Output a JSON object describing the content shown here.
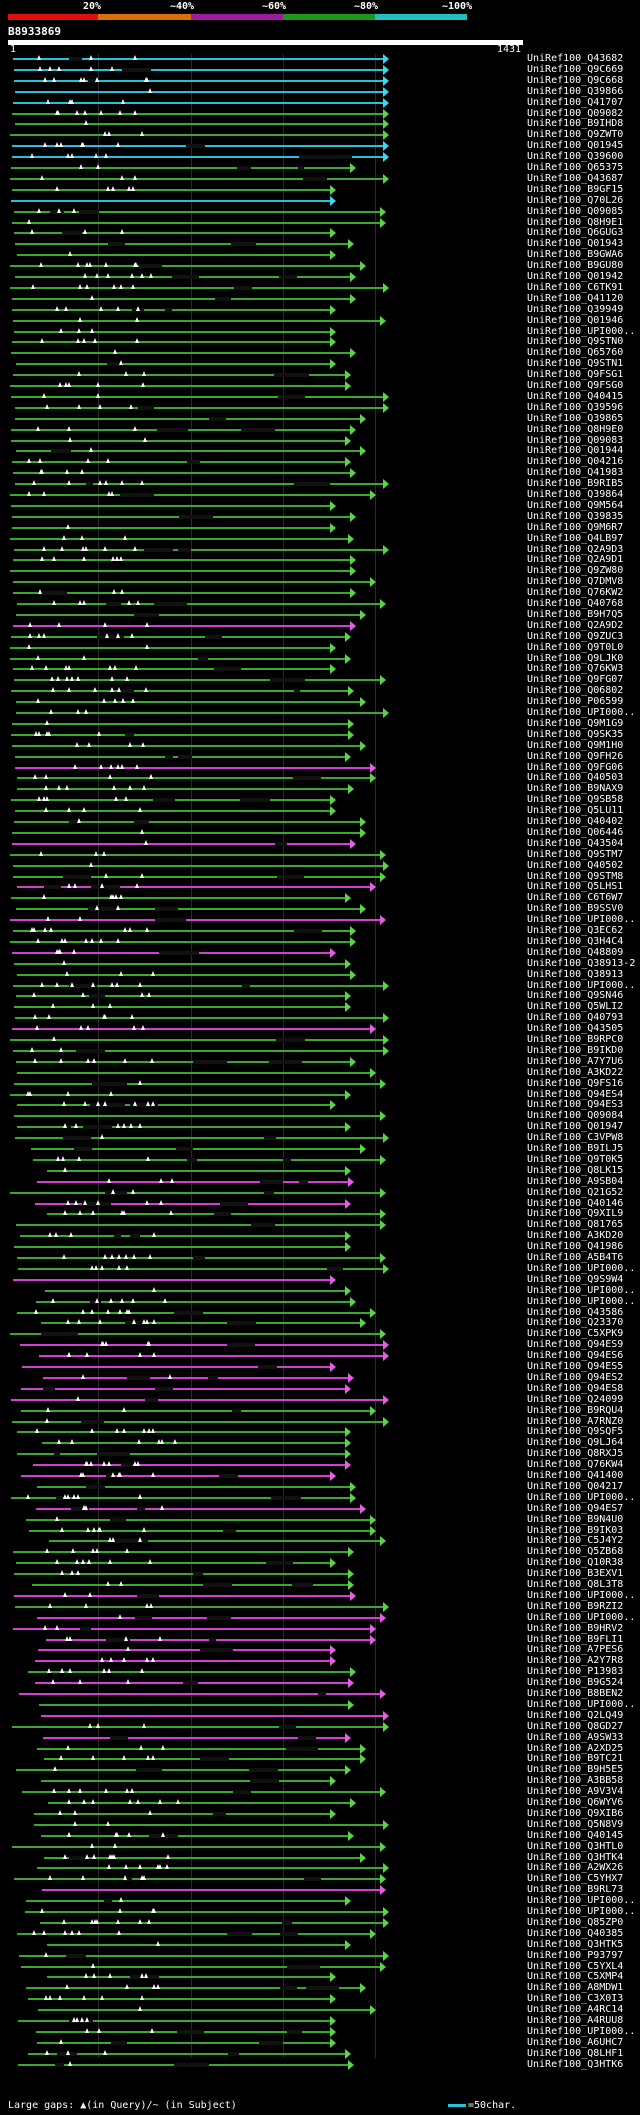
{
  "scale": {
    "labels": [
      "20%",
      "~40%",
      "~60%",
      "~80%",
      "~100%"
    ],
    "bands": [
      "#e01010",
      "#d8700a",
      "#a01aa0",
      "#1a9a1a",
      "#20c0c0"
    ]
  },
  "query": {
    "id": "B8933869",
    "start": "1",
    "end": "1431"
  },
  "colors": {
    "green": "#3aa82e",
    "magenta": "#d23fd2",
    "cyan": "#29bfd9",
    "arrow_green": "#5bd44a",
    "arrow_magenta": "#e060e0",
    "arrow_cyan": "#3cd8f0"
  },
  "legend": {
    "left": "Large gaps: ▲(in Query)/~ (in Subject)",
    "right": "=50char."
  },
  "hits": [
    {
      "label": "UniRef100_Q43682",
      "color": "cyan"
    },
    {
      "label": "UniRef100_Q9C669",
      "color": "cyan"
    },
    {
      "label": "UniRef100_Q9C668",
      "color": "cyan"
    },
    {
      "label": "UniRef100_Q39866",
      "color": "cyan"
    },
    {
      "label": "UniRef100_Q41707",
      "color": "cyan"
    },
    {
      "label": "UniRef100_Q09082",
      "color": "green"
    },
    {
      "label": "UniRef100_B9IHD8",
      "color": "green"
    },
    {
      "label": "UniRef100_Q9ZWT0",
      "color": "green"
    },
    {
      "label": "UniRef100_Q01945",
      "color": "cyan"
    },
    {
      "label": "UniRef100_Q39600",
      "color": "cyan"
    },
    {
      "label": "UniRef100_Q65375",
      "color": "green"
    },
    {
      "label": "UniRef100_Q43687",
      "color": "green"
    },
    {
      "label": "UniRef100_B9GF15",
      "color": "green"
    },
    {
      "label": "UniRef100_Q70L26",
      "color": "cyan"
    },
    {
      "label": "UniRef100_Q09085",
      "color": "green"
    },
    {
      "label": "UniRef100_Q8H9E1",
      "color": "green"
    },
    {
      "label": "UniRef100_Q6GUG3",
      "color": "green"
    },
    {
      "label": "UniRef100_Q01943",
      "color": "green"
    },
    {
      "label": "UniRef100_B9GWA6",
      "color": "green"
    },
    {
      "label": "UniRef100_B9GU80",
      "color": "green"
    },
    {
      "label": "UniRef100_Q01942",
      "color": "green"
    },
    {
      "label": "UniRef100_C6TK91",
      "color": "green"
    },
    {
      "label": "UniRef100_Q41120",
      "color": "green"
    },
    {
      "label": "UniRef100_Q39949",
      "color": "green"
    },
    {
      "label": "UniRef100_Q01946",
      "color": "green"
    },
    {
      "label": "UniRef100_UPI000..",
      "color": "green"
    },
    {
      "label": "UniRef100_Q9STN0",
      "color": "green"
    },
    {
      "label": "UniRef100_Q65760",
      "color": "green"
    },
    {
      "label": "UniRef100_Q9STN1",
      "color": "green"
    },
    {
      "label": "UniRef100_Q9FSG1",
      "color": "green"
    },
    {
      "label": "UniRef100_Q9FSG0",
      "color": "green"
    },
    {
      "label": "UniRef100_Q40415",
      "color": "green"
    },
    {
      "label": "UniRef100_Q39596",
      "color": "green"
    },
    {
      "label": "UniRef100_Q39865",
      "color": "green"
    },
    {
      "label": "UniRef100_Q8H9E0",
      "color": "green"
    },
    {
      "label": "UniRef100_Q09083",
      "color": "green"
    },
    {
      "label": "UniRef100_Q01944",
      "color": "green"
    },
    {
      "label": "UniRef100_Q04216",
      "color": "green"
    },
    {
      "label": "UniRef100_Q41983",
      "color": "green"
    },
    {
      "label": "UniRef100_B9RIB5",
      "color": "green"
    },
    {
      "label": "UniRef100_Q39864",
      "color": "green"
    },
    {
      "label": "UniRef100_Q9M564",
      "color": "green"
    },
    {
      "label": "UniRef100_Q39835",
      "color": "green"
    },
    {
      "label": "UniRef100_Q9M6R7",
      "color": "green"
    },
    {
      "label": "UniRef100_Q4LB97",
      "color": "green"
    },
    {
      "label": "UniRef100_Q2A9D3",
      "color": "green"
    },
    {
      "label": "UniRef100_Q2A9D1",
      "color": "green"
    },
    {
      "label": "UniRef100_Q9ZW80",
      "color": "green"
    },
    {
      "label": "UniRef100_Q7DMV8",
      "color": "green"
    },
    {
      "label": "UniRef100_Q76KW2",
      "color": "green"
    },
    {
      "label": "UniRef100_Q40768",
      "color": "green"
    },
    {
      "label": "UniRef100_B9H7Q5",
      "color": "green"
    },
    {
      "label": "UniRef100_Q2A9D2",
      "color": "magenta"
    },
    {
      "label": "UniRef100_Q9ZUC3",
      "color": "green"
    },
    {
      "label": "UniRef100_Q9T0L0",
      "color": "green"
    },
    {
      "label": "UniRef100_Q9LJK0",
      "color": "green"
    },
    {
      "label": "UniRef100_Q76KW3",
      "color": "green"
    },
    {
      "label": "UniRef100_Q9FG07",
      "color": "green"
    },
    {
      "label": "UniRef100_Q06802",
      "color": "green"
    },
    {
      "label": "UniRef100_P06599",
      "color": "green"
    },
    {
      "label": "UniRef100_UPI000..",
      "color": "green"
    },
    {
      "label": "UniRef100_Q9M1G9",
      "color": "green"
    },
    {
      "label": "UniRef100_Q9SK35",
      "color": "green"
    },
    {
      "label": "UniRef100_Q9M1H0",
      "color": "green"
    },
    {
      "label": "UniRef100_Q9FH26",
      "color": "green"
    },
    {
      "label": "UniRef100_Q9FG06",
      "color": "magenta"
    },
    {
      "label": "UniRef100_Q40503",
      "color": "green"
    },
    {
      "label": "UniRef100_B9NAX9",
      "color": "green"
    },
    {
      "label": "UniRef100_Q9SB58",
      "color": "green"
    },
    {
      "label": "UniRef100_Q5LU11",
      "color": "green"
    },
    {
      "label": "UniRef100_Q40402",
      "color": "green"
    },
    {
      "label": "UniRef100_Q06446",
      "color": "green"
    },
    {
      "label": "UniRef100_Q43504",
      "color": "magenta"
    },
    {
      "label": "UniRef100_Q9STM7",
      "color": "green"
    },
    {
      "label": "UniRef100_Q40502",
      "color": "green"
    },
    {
      "label": "UniRef100_Q9STM8",
      "color": "green"
    },
    {
      "label": "UniRef100_Q5LHS1",
      "color": "magenta"
    },
    {
      "label": "UniRef100_C6T6W7",
      "color": "green"
    },
    {
      "label": "UniRef100_B9SSV0",
      "color": "green"
    },
    {
      "label": "UniRef100_UPI000..",
      "color": "magenta"
    },
    {
      "label": "UniRef100_Q3EC62",
      "color": "green"
    },
    {
      "label": "UniRef100_Q3H4C4",
      "color": "green"
    },
    {
      "label": "UniRef100_Q48809",
      "color": "magenta"
    },
    {
      "label": "UniRef100_Q38913-2",
      "color": "green"
    },
    {
      "label": "UniRef100_Q38913",
      "color": "green"
    },
    {
      "label": "UniRef100_UPI000..",
      "color": "green"
    },
    {
      "label": "UniRef100_Q9SN46",
      "color": "green"
    },
    {
      "label": "UniRef100_Q5WLI2",
      "color": "green"
    },
    {
      "label": "UniRef100_Q40793",
      "color": "green"
    },
    {
      "label": "UniRef100_Q43505",
      "color": "magenta"
    },
    {
      "label": "UniRef100_B9RPC0",
      "color": "green"
    },
    {
      "label": "UniRef100_B9IKD0",
      "color": "green"
    },
    {
      "label": "UniRef100_A7Y7U6",
      "color": "green"
    },
    {
      "label": "UniRef100_A3KD22",
      "color": "green"
    },
    {
      "label": "UniRef100_Q9FS16",
      "color": "green"
    },
    {
      "label": "UniRef100_Q94ES4",
      "color": "green"
    },
    {
      "label": "UniRef100_Q94ES3",
      "color": "green"
    },
    {
      "label": "UniRef100_Q09084",
      "color": "green"
    },
    {
      "label": "UniRef100_Q01947",
      "color": "green"
    },
    {
      "label": "UniRef100_C3VPW8",
      "color": "green"
    },
    {
      "label": "UniRef100_B9ILJ5",
      "color": "green"
    },
    {
      "label": "UniRef100_Q9T0K5",
      "color": "green"
    },
    {
      "label": "UniRef100_Q8LK15",
      "color": "green"
    },
    {
      "label": "UniRef100_A9SB04",
      "color": "magenta"
    },
    {
      "label": "UniRef100_Q21G52",
      "color": "green"
    },
    {
      "label": "UniRef100_Q40146",
      "color": "magenta"
    },
    {
      "label": "UniRef100_Q9XIL9",
      "color": "green"
    },
    {
      "label": "UniRef100_Q81765",
      "color": "green"
    },
    {
      "label": "UniRef100_A3KD20",
      "color": "green"
    },
    {
      "label": "UniRef100_Q41986",
      "color": "green"
    },
    {
      "label": "UniRef100_A5B4T6",
      "color": "green"
    },
    {
      "label": "UniRef100_UPI000..",
      "color": "green"
    },
    {
      "label": "UniRef100_Q9S9W4",
      "color": "magenta"
    },
    {
      "label": "UniRef100_UPI000..",
      "color": "green"
    },
    {
      "label": "UniRef100_UPI000..",
      "color": "green"
    },
    {
      "label": "UniRef100_Q43586",
      "color": "green"
    },
    {
      "label": "UniRef100_Q23370",
      "color": "green"
    },
    {
      "label": "UniRef100_C5XPK9",
      "color": "green"
    },
    {
      "label": "UniRef100_Q94ES9",
      "color": "magenta"
    },
    {
      "label": "UniRef100_Q94ES6",
      "color": "magenta"
    },
    {
      "label": "UniRef100_Q94ES5",
      "color": "magenta"
    },
    {
      "label": "UniRef100_Q94ES2",
      "color": "magenta"
    },
    {
      "label": "UniRef100_Q94ES8",
      "color": "magenta"
    },
    {
      "label": "UniRef100_Q24099",
      "color": "magenta"
    },
    {
      "label": "UniRef100_B9RQU4",
      "color": "green"
    },
    {
      "label": "UniRef100_A7RNZ0",
      "color": "green"
    },
    {
      "label": "UniRef100_Q9SQF5",
      "color": "green"
    },
    {
      "label": "UniRef100_Q9LJ64",
      "color": "green"
    },
    {
      "label": "UniRef100_Q8RXJ5",
      "color": "green"
    },
    {
      "label": "UniRef100_Q76KW4",
      "color": "magenta"
    },
    {
      "label": "UniRef100_Q41400",
      "color": "magenta"
    },
    {
      "label": "UniRef100_Q04217",
      "color": "green"
    },
    {
      "label": "UniRef100_UPI000..",
      "color": "green"
    },
    {
      "label": "UniRef100_Q94ES7",
      "color": "magenta"
    },
    {
      "label": "UniRef100_B9N4U0",
      "color": "green"
    },
    {
      "label": "UniRef100_B9IK03",
      "color": "green"
    },
    {
      "label": "UniRef100_C5J4Y2",
      "color": "green"
    },
    {
      "label": "UniRef100_Q5ZB68",
      "color": "green"
    },
    {
      "label": "UniRef100_Q10R38",
      "color": "green"
    },
    {
      "label": "UniRef100_B3EXV1",
      "color": "green"
    },
    {
      "label": "UniRef100_Q8L3T8",
      "color": "green"
    },
    {
      "label": "UniRef100_UPI000..",
      "color": "magenta"
    },
    {
      "label": "UniRef100_B9RZI2",
      "color": "green"
    },
    {
      "label": "UniRef100_UPI000..",
      "color": "magenta"
    },
    {
      "label": "UniRef100_B9HRV2",
      "color": "magenta"
    },
    {
      "label": "UniRef100_B9FLI1",
      "color": "magenta"
    },
    {
      "label": "UniRef100_A7PES6",
      "color": "magenta"
    },
    {
      "label": "UniRef100_A2Y7R8",
      "color": "magenta"
    },
    {
      "label": "UniRef100_P13983",
      "color": "green"
    },
    {
      "label": "UniRef100_B9G524",
      "color": "magenta"
    },
    {
      "label": "UniRef100_B8BEN2",
      "color": "magenta"
    },
    {
      "label": "UniRef100_UPI000..",
      "color": "green"
    },
    {
      "label": "UniRef100_Q2LQ49",
      "color": "magenta"
    },
    {
      "label": "UniRef100_Q8GD27",
      "color": "green"
    },
    {
      "label": "UniRef100_A9SW33",
      "color": "magenta"
    },
    {
      "label": "UniRef100_A2XD25",
      "color": "green"
    },
    {
      "label": "UniRef100_B9TC21",
      "color": "green"
    },
    {
      "label": "UniRef100_B9H5E5",
      "color": "green"
    },
    {
      "label": "UniRef100_A3BB58",
      "color": "green"
    },
    {
      "label": "UniRef100_A9V3V4",
      "color": "green"
    },
    {
      "label": "UniRef100_Q6WYV6",
      "color": "green"
    },
    {
      "label": "UniRef100_Q9XIB6",
      "color": "green"
    },
    {
      "label": "UniRef100_Q5N8V9",
      "color": "green"
    },
    {
      "label": "UniRef100_Q40145",
      "color": "green"
    },
    {
      "label": "UniRef100_Q3HTL0",
      "color": "green"
    },
    {
      "label": "UniRef100_Q3HTK4",
      "color": "green"
    },
    {
      "label": "UniRef100_A2WX26",
      "color": "green"
    },
    {
      "label": "UniRef100_C5YHX7",
      "color": "green"
    },
    {
      "label": "UniRef100_B9RL73",
      "color": "magenta"
    },
    {
      "label": "UniRef100_UPI000..",
      "color": "green"
    },
    {
      "label": "UniRef100_UPI000..",
      "color": "green"
    },
    {
      "label": "UniRef100_Q85ZP0",
      "color": "green"
    },
    {
      "label": "UniRef100_Q40385",
      "color": "green"
    },
    {
      "label": "UniRef100_Q3HTK5",
      "color": "green"
    },
    {
      "label": "UniRef100_P93797",
      "color": "green"
    },
    {
      "label": "UniRef100_C5YXL4",
      "color": "green"
    },
    {
      "label": "UniRef100_C5XMP4",
      "color": "green"
    },
    {
      "label": "UniRef100_A8MDW1",
      "color": "green"
    },
    {
      "label": "UniRef100_C3X0I3",
      "color": "green"
    },
    {
      "label": "UniRef100_A4RC14",
      "color": "green"
    },
    {
      "label": "UniRef100_A4RUU8",
      "color": "green"
    },
    {
      "label": "UniRef100_UPI000..",
      "color": "green"
    },
    {
      "label": "UniRef100_A6UHC7",
      "color": "green"
    },
    {
      "label": "UniRef100_Q8LHF1",
      "color": "green"
    },
    {
      "label": "UniRef100_Q3HTK6",
      "color": "green"
    }
  ]
}
